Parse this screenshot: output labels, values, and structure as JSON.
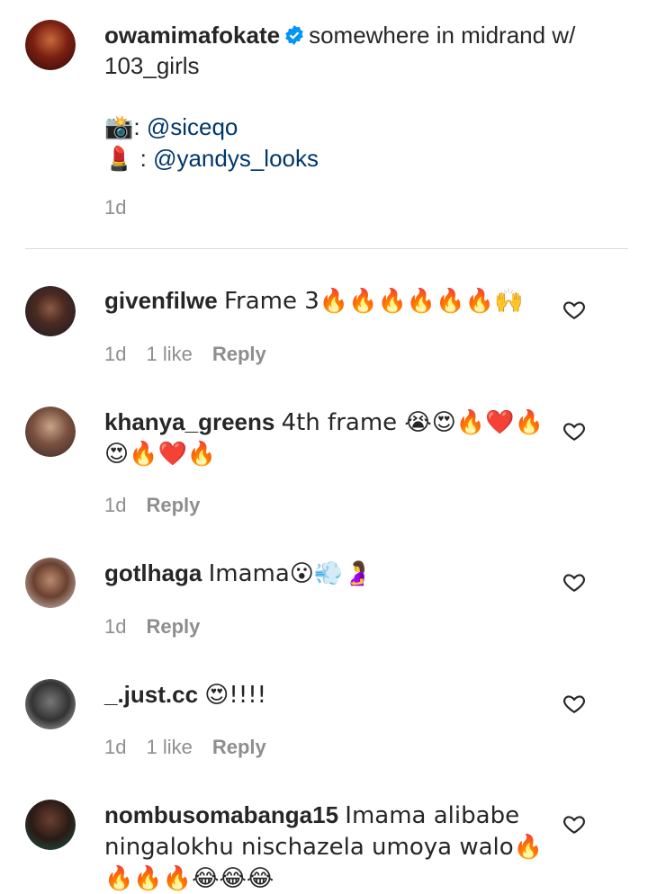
{
  "caption": {
    "username": "owamimafokate",
    "text": "somewhere in midrand w/ 103_girls",
    "credits": [
      {
        "icon": "📸",
        "sep": ":",
        "handle": "@siceqo"
      },
      {
        "icon": "💄",
        "sep": ":",
        "handle": "@yandys_looks"
      }
    ],
    "time": "1d"
  },
  "comments": [
    {
      "username": "givenfilwe",
      "text": "Frame 3🔥🔥🔥🔥🔥🔥🙌",
      "time": "1d",
      "likes": "1 like",
      "reply": "Reply"
    },
    {
      "username": "khanya_greens",
      "text": "4th frame 😭😍🔥❤️🔥😍🔥❤️🔥",
      "time": "1d",
      "likes": "",
      "reply": "Reply"
    },
    {
      "username": "gotlhaga",
      "text": "Imama😮💨🤰",
      "time": "1d",
      "likes": "",
      "reply": "Reply"
    },
    {
      "username": "_.just.cc",
      "text": "😍!!!!",
      "time": "1d",
      "likes": "1 like",
      "reply": "Reply"
    },
    {
      "username": "nombusomabanga15",
      "text": "Imama alibabe ningalokhu nischazela umoya walo🔥🔥🔥🔥😂😂😂",
      "time": "",
      "likes": "",
      "reply": ""
    }
  ],
  "colors": {
    "text": "#262626",
    "meta": "#8e8e8e",
    "link": "#00376b",
    "verified": "#0095f6",
    "divider": "#dbdbdb"
  }
}
